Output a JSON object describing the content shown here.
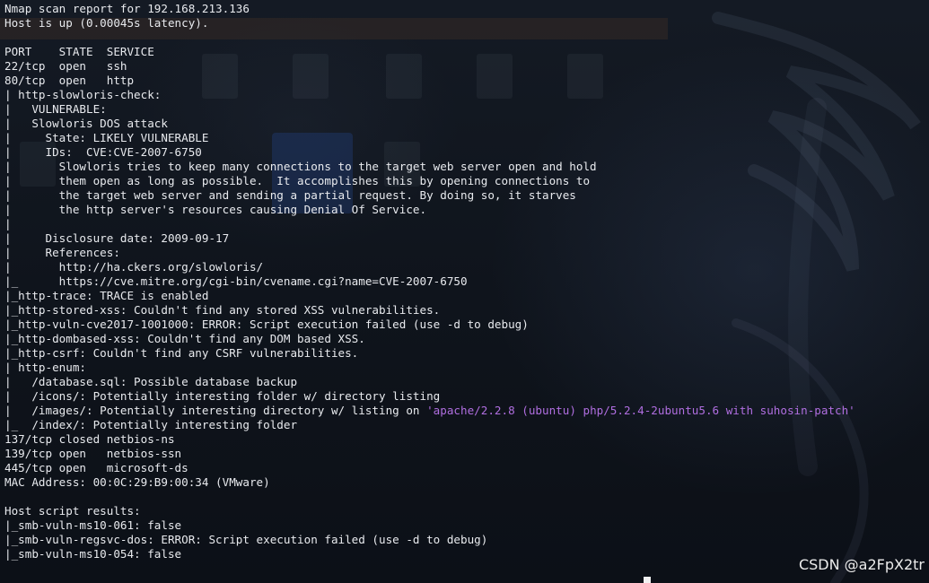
{
  "terminal": {
    "lines": [
      "Nmap scan report for 192.168.213.136",
      "Host is up (0.00045s latency).",
      "",
      "PORT    STATE  SERVICE",
      "22/tcp  open   ssh",
      "80/tcp  open   http",
      "| http-slowloris-check:",
      "|   VULNERABLE:",
      "|   Slowloris DOS attack",
      "|     State: LIKELY VULNERABLE",
      "|     IDs:  CVE:CVE-2007-6750",
      "|       Slowloris tries to keep many connections to the target web server open and hold",
      "|       them open as long as possible.  It accomplishes this by opening connections to",
      "|       the target web server and sending a partial request. By doing so, it starves",
      "|       the http server's resources causing Denial Of Service.",
      "|",
      "|     Disclosure date: 2009-09-17",
      "|     References:",
      "|       http://ha.ckers.org/slowloris/",
      "|_      https://cve.mitre.org/cgi-bin/cvename.cgi?name=CVE-2007-6750",
      "|_http-trace: TRACE is enabled",
      "|_http-stored-xss: Couldn't find any stored XSS vulnerabilities.",
      "|_http-vuln-cve2017-1001000: ERROR: Script execution failed (use -d to debug)",
      "|_http-dombased-xss: Couldn't find any DOM based XSS.",
      "|_http-csrf: Couldn't find any CSRF vulnerabilities.",
      "| http-enum:",
      "|   /database.sql: Possible database backup",
      "|   /icons/: Potentially interesting folder w/ directory listing",
      "|   /images/: Potentially interesting directory w/ listing on ",
      "|_  /index/: Potentially interesting folder",
      "137/tcp closed netbios-ns",
      "139/tcp open   netbios-ssn",
      "445/tcp open   microsoft-ds",
      "MAC Address: 00:0C:29:B9:00:34 (VMware)",
      "",
      "Host script results:",
      "|_smb-vuln-ms10-061: false",
      "|_smb-vuln-regsvc-dos: ERROR: Script execution failed (use -d to debug)",
      "|_smb-vuln-ms10-054: false"
    ],
    "images_listing_suffix": "'apache/2.2.8 (ubuntu) php/5.2.4-2ubuntu5.6 with suhosin-patch'"
  },
  "watermark": "CSDN @a2FpX2tr",
  "colors": {
    "text": "#e8eaee",
    "highlight_string": "#b06ee0",
    "background": "#0d1117"
  }
}
